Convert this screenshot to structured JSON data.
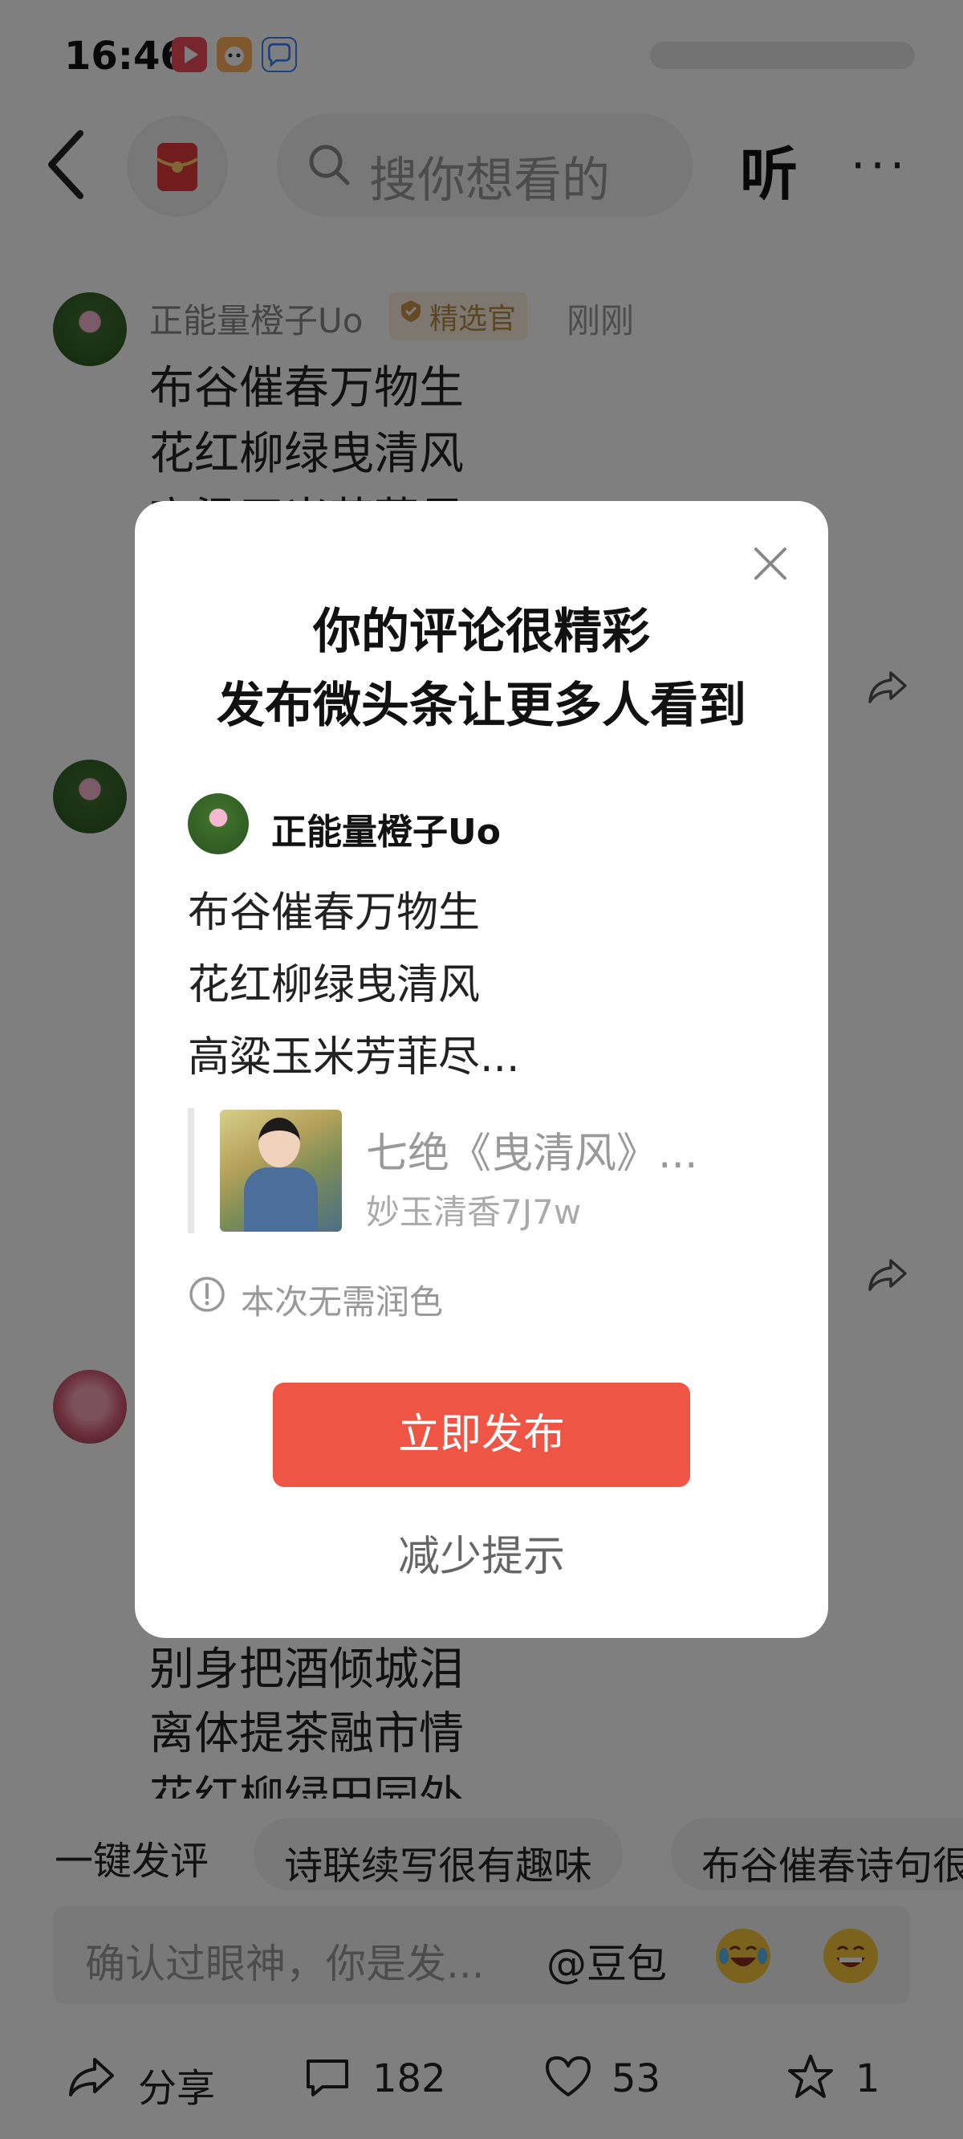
{
  "status_bar": {
    "time": "16:46",
    "app_icons": [
      "video-app-icon",
      "cloud-app-icon",
      "chat-app-icon"
    ],
    "app_colors": [
      "#f14b5a",
      "#ffb15c",
      "#3b82f6"
    ]
  },
  "top_bar": {
    "search_placeholder": "搜你想看的",
    "listen_label": "听",
    "more_label": "···"
  },
  "comments": [
    {
      "author": "正能量橙子Uo",
      "badge": "精选官",
      "time": "刚刚",
      "lines": [
        "布谷催春万物生",
        "花红柳绿曳清风",
        "高粱玉米芳菲尽"
      ]
    },
    {
      "lines": [
        "别身把酒倾城泪",
        "离体提茶融市情",
        "花红柳绿田园外"
      ]
    }
  ],
  "suggestions": {
    "lead": "一键发评",
    "chips": [
      "诗联续写很有趣味",
      "布谷催春诗句很"
    ]
  },
  "input_bar": {
    "placeholder": "确认过眼神，你是发...",
    "mention": "@豆包"
  },
  "actions": {
    "share_label": "分享",
    "comment_count": "182",
    "like_count": "53",
    "favorite_count": "1"
  },
  "modal": {
    "title_line1": "你的评论很精彩",
    "title_line2": "发布微头条让更多人看到",
    "author": "正能量橙子Uo",
    "lines": [
      "布谷催春万物生",
      "花红柳绿曳清风",
      "高粱玉米芳菲尽..."
    ],
    "quote_title": "七绝《曳清风》...",
    "quote_author": "妙玉清香7J7w",
    "note": "本次无需润色",
    "publish_label": "立即发布",
    "reduce_label": "减少提示"
  },
  "colors": {
    "accent": "#ee5544",
    "badge_bg": "#fbeede",
    "badge_text": "#b88a45"
  }
}
